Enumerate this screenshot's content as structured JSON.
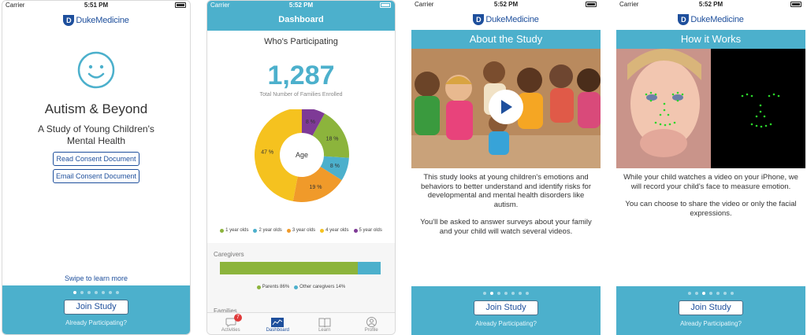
{
  "status": {
    "carrier": "Carrier",
    "time": "5:51 PM",
    "time2": "5:52 PM"
  },
  "brand": {
    "duke": "Duke",
    "medicine": "Medicine"
  },
  "screen1": {
    "title": "Autism & Beyond",
    "subtitle": "A Study of Young Children's Mental Health",
    "read_consent": "Read Consent Document",
    "email_consent": "Email Consent Document",
    "swipe": "Swipe to learn more"
  },
  "common": {
    "join": "Join Study",
    "already": "Already Participating?"
  },
  "screen2": {
    "header": "Dashboard",
    "who": "Who's Participating",
    "count": "1,287",
    "total_label": "Total Number of Families Enrolled",
    "donut_center": "Age",
    "caregivers": "Caregivers",
    "families": "Families",
    "tabs": [
      "Activities",
      "Dashboard",
      "Learn",
      "Profile"
    ],
    "badge": "7"
  },
  "screen3": {
    "header": "About the Study",
    "p1": "This study looks at young children's emotions and behaviors to better understand and identify risks for developmental and mental health disorders like autism.",
    "p2": "You'll be asked to answer surveys about your family and your child will watch several videos."
  },
  "screen4": {
    "header": "How it Works",
    "p1": "While your child watches a video on your iPhone, we will record your child's face to measure emotion.",
    "p2": "You can choose to share the video or only the facial expressions."
  },
  "colors": {
    "teal": "#4cb0cc",
    "duke_blue": "#1e4f9c",
    "green": "#8cb43c",
    "blue": "#4cb0cc",
    "orange": "#f09a2a",
    "yellow": "#f5c21f",
    "purple": "#7e3a96"
  },
  "chart_data": [
    {
      "type": "pie",
      "categories": [
        "1 year olds",
        "2 year olds",
        "3 year olds",
        "4 year olds",
        "5 year olds"
      ],
      "values": [
        18,
        8,
        19,
        47,
        8
      ],
      "labels": [
        "18 %",
        "8 %",
        "19 %",
        "47 %",
        "8 %"
      ]
    },
    {
      "type": "bar",
      "categories": [
        "Parents 86%",
        "Other caregivers 14%"
      ],
      "values": [
        86,
        14
      ]
    }
  ]
}
